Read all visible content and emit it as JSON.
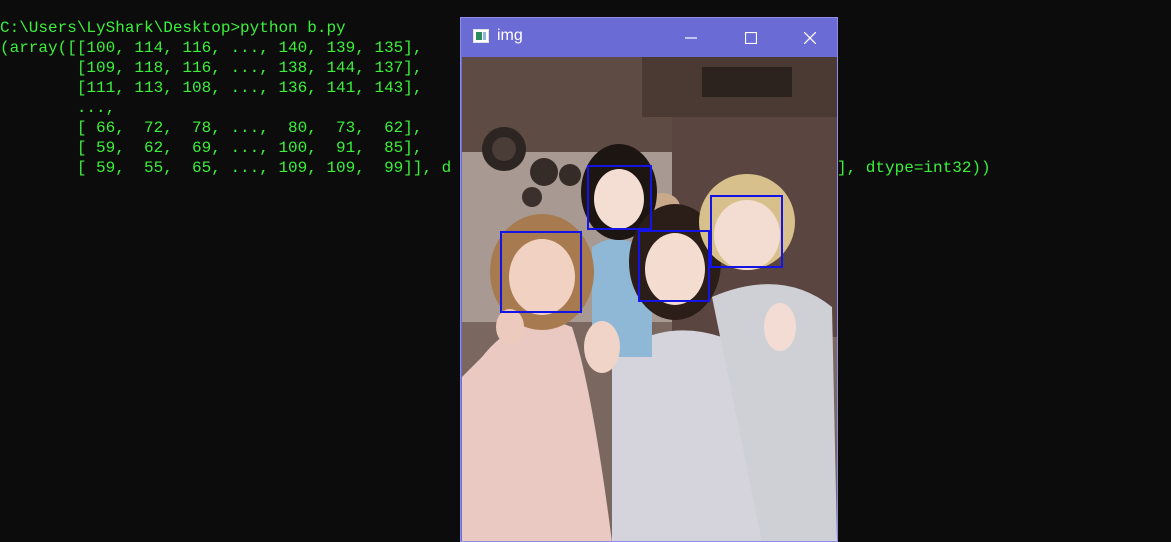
{
  "console": {
    "lines": [
      "C:\\Users\\LyShark\\Desktop>python b.py",
      "(array([[100, 114, 116, ..., 140, 139, 135],",
      "        [109, 118, 116, ..., 138, 144, 137],",
      "        [111, 113, 108, ..., 136, 141, 143],",
      "        ...,",
      "        [ 66,  72,  78, ...,  80,  73,  62],",
      "        [ 59,  62,  69, ..., 100,  91,  85],",
      "        [ 59,  55,  65, ..., 109, 109,  99]], d"
    ],
    "tail_text": "], dtype=int32))",
    "text_color": "#3bf03b",
    "background": "#0c0c0c"
  },
  "window": {
    "title": "img",
    "icon": "image-window-icon",
    "titlebar_color": "#6b6bd6",
    "controls": [
      "minimize-icon",
      "maximize-icon",
      "close-icon"
    ],
    "face_box_color": "#1414e6",
    "face_boxes_count": 4
  }
}
